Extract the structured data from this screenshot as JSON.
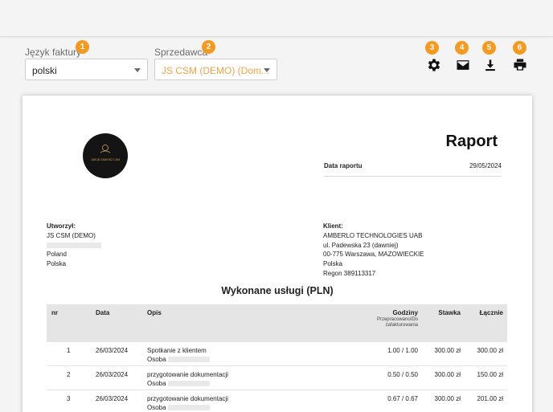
{
  "toolbar": {
    "invoice_language": {
      "label": "Język faktury",
      "value": "polski",
      "badge": "1"
    },
    "seller": {
      "label": "Sprzedawca",
      "value": "JS CSM (DEMO) (Dom...",
      "badge": "2"
    },
    "actions": [
      {
        "icon": "gear-icon",
        "badge": "3"
      },
      {
        "icon": "mail-icon",
        "badge": "4"
      },
      {
        "icon": "download-icon",
        "badge": "5"
      },
      {
        "icon": "print-icon",
        "badge": "6"
      }
    ],
    "accent_color": "#f59a1f"
  },
  "report": {
    "logo_text": "JAKUB SAWOSZ CSM",
    "title": "Raport",
    "date_label": "Data raportu",
    "date_value": "29/05/2024",
    "creator": {
      "heading": "Utworzył:",
      "name": "JS CSM (DEMO)",
      "line2": "Poland",
      "line3": "Polska"
    },
    "client": {
      "heading": "Klient:",
      "lines": [
        "AMBERLO TECHNOLOGIES UAB",
        "ul. Padewska 23 (dawniej)",
        "00-775 Warszawa, MAZOWIECKIE",
        "Polska",
        "Regon 389113317"
      ]
    },
    "services_title": "Wykonane usługi (PLN)",
    "table": {
      "headers": {
        "nr": "nr",
        "data": "Data",
        "opis": "Opis",
        "godziny": "Godziny",
        "godziny_sub1": "Przepracowano/Do",
        "godziny_sub2": "zafakturowania",
        "stawka": "Stawka",
        "lacznie": "Łącznie"
      },
      "rows": [
        {
          "nr": "1",
          "data": "26/03/2024",
          "opis": "Spotkanie z klientem",
          "osoba": "Osoba",
          "godziny": "1.00 /  1.00",
          "stawka": "300.00 zł",
          "lacznie": "300.00 zł"
        },
        {
          "nr": "2",
          "data": "26/03/2024",
          "opis": "przygotowanie dokumentacji",
          "osoba": "Osoba",
          "godziny": "0.50 /  0.50",
          "stawka": "300.00 zł",
          "lacznie": "150.00 zł"
        },
        {
          "nr": "3",
          "data": "26/03/2024",
          "opis": "przygotowanie dokumentacji",
          "osoba": "Osoba",
          "godziny": "0.67 /  0.67",
          "stawka": "300.00 zł",
          "lacznie": "201.00 zł"
        }
      ]
    }
  }
}
